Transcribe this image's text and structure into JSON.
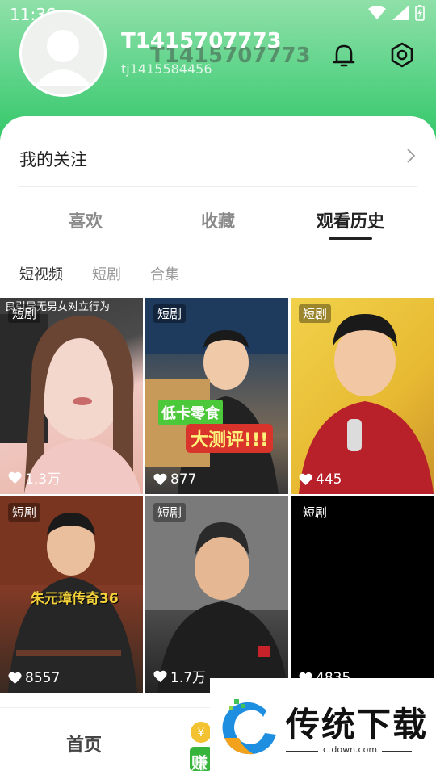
{
  "status_bar": {
    "time": "11:36"
  },
  "profile": {
    "username": "T1415707773",
    "username_shadow": "T1415707773",
    "user_id": "tj1415584456"
  },
  "follow": {
    "label": "我的关注"
  },
  "tabs": [
    {
      "label": "喜欢",
      "active": false
    },
    {
      "label": "收藏",
      "active": false
    },
    {
      "label": "观看历史",
      "active": true
    }
  ],
  "subtabs": [
    {
      "label": "短视频",
      "active": true
    },
    {
      "label": "短剧",
      "active": false
    },
    {
      "label": "合集",
      "active": false
    }
  ],
  "videos": [
    {
      "badge": "短剧",
      "likes": "1.3万",
      "overlay_text": "良引导无男女对立行为"
    },
    {
      "badge": "短剧",
      "likes": "877",
      "caption_1": "低卡零食",
      "caption_2": "大测评!!!"
    },
    {
      "badge": "短剧",
      "likes": "445"
    },
    {
      "badge": "短剧",
      "likes": "8557",
      "caption_1": "朱元璋传奇36"
    },
    {
      "badge": "短剧",
      "likes": "1.7万"
    },
    {
      "badge": "短剧",
      "likes": "4835"
    }
  ],
  "bottom_nav": {
    "home": "首页",
    "earn": "赚"
  },
  "watermark": {
    "brand": "传统下载",
    "url": "ctdown.com"
  },
  "colors": {
    "header_green": "#27c35e",
    "accent_dark": "#222222"
  }
}
